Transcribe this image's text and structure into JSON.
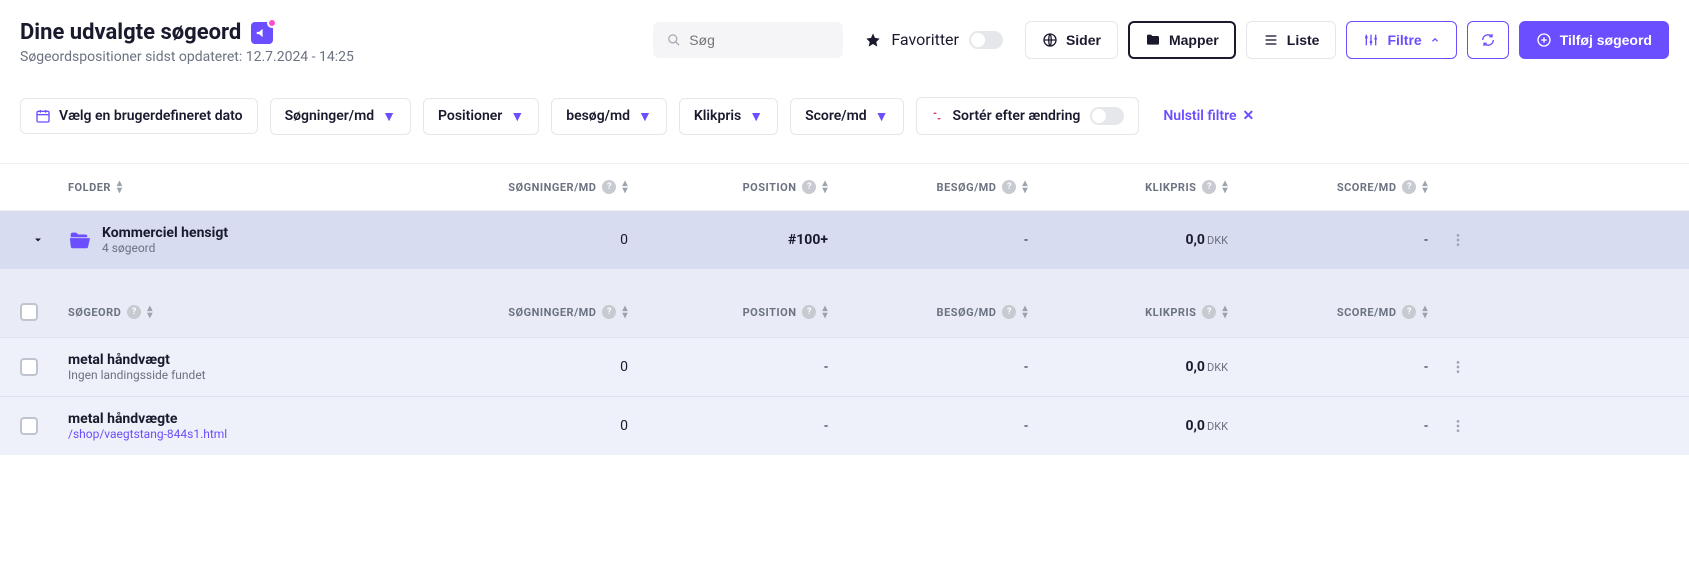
{
  "header": {
    "title": "Dine udvalgte søgeord",
    "subtitle": "Søgeordspositioner sidst opdateret: 12.7.2024 - 14:25",
    "search_placeholder": "Søg",
    "favorites_label": "Favoritter",
    "pages_label": "Sider",
    "folders_label": "Mapper",
    "list_label": "Liste",
    "filters_label": "Filtre",
    "add_keyword_label": "Tilføj søgeord"
  },
  "filters": {
    "custom_date": "Vælg en brugerdefineret dato",
    "searches": "Søgninger/md",
    "positions": "Positioner",
    "visits": "besøg/md",
    "cpc": "Klikpris",
    "score": "Score/md",
    "sort_change": "Sortér efter ændring",
    "reset": "Nulstil filtre"
  },
  "columns": {
    "folder": "FOLDER",
    "keyword": "SØGEORD",
    "searches": "SØGNINGER/MD",
    "position": "POSITION",
    "visits": "BESØG/MD",
    "cpc": "KLIKPRIS",
    "score": "SCORE/MD"
  },
  "folder": {
    "name": "Kommerciel hensigt",
    "count": "4 søgeord",
    "searches": "0",
    "position": "#100+",
    "visits": "-",
    "cpc_value": "0,0",
    "cpc_currency": "DKK",
    "score": "-"
  },
  "keywords": [
    {
      "name": "metal håndvægt",
      "sub": "Ingen landingsside fundet",
      "is_link": false,
      "searches": "0",
      "position": "-",
      "visits": "-",
      "cpc_value": "0,0",
      "cpc_currency": "DKK",
      "score": "-"
    },
    {
      "name": "metal håndvægte",
      "sub": "/shop/vaegtstang-844s1.html",
      "is_link": true,
      "searches": "0",
      "position": "-",
      "visits": "-",
      "cpc_value": "0,0",
      "cpc_currency": "DKK",
      "score": "-"
    }
  ]
}
